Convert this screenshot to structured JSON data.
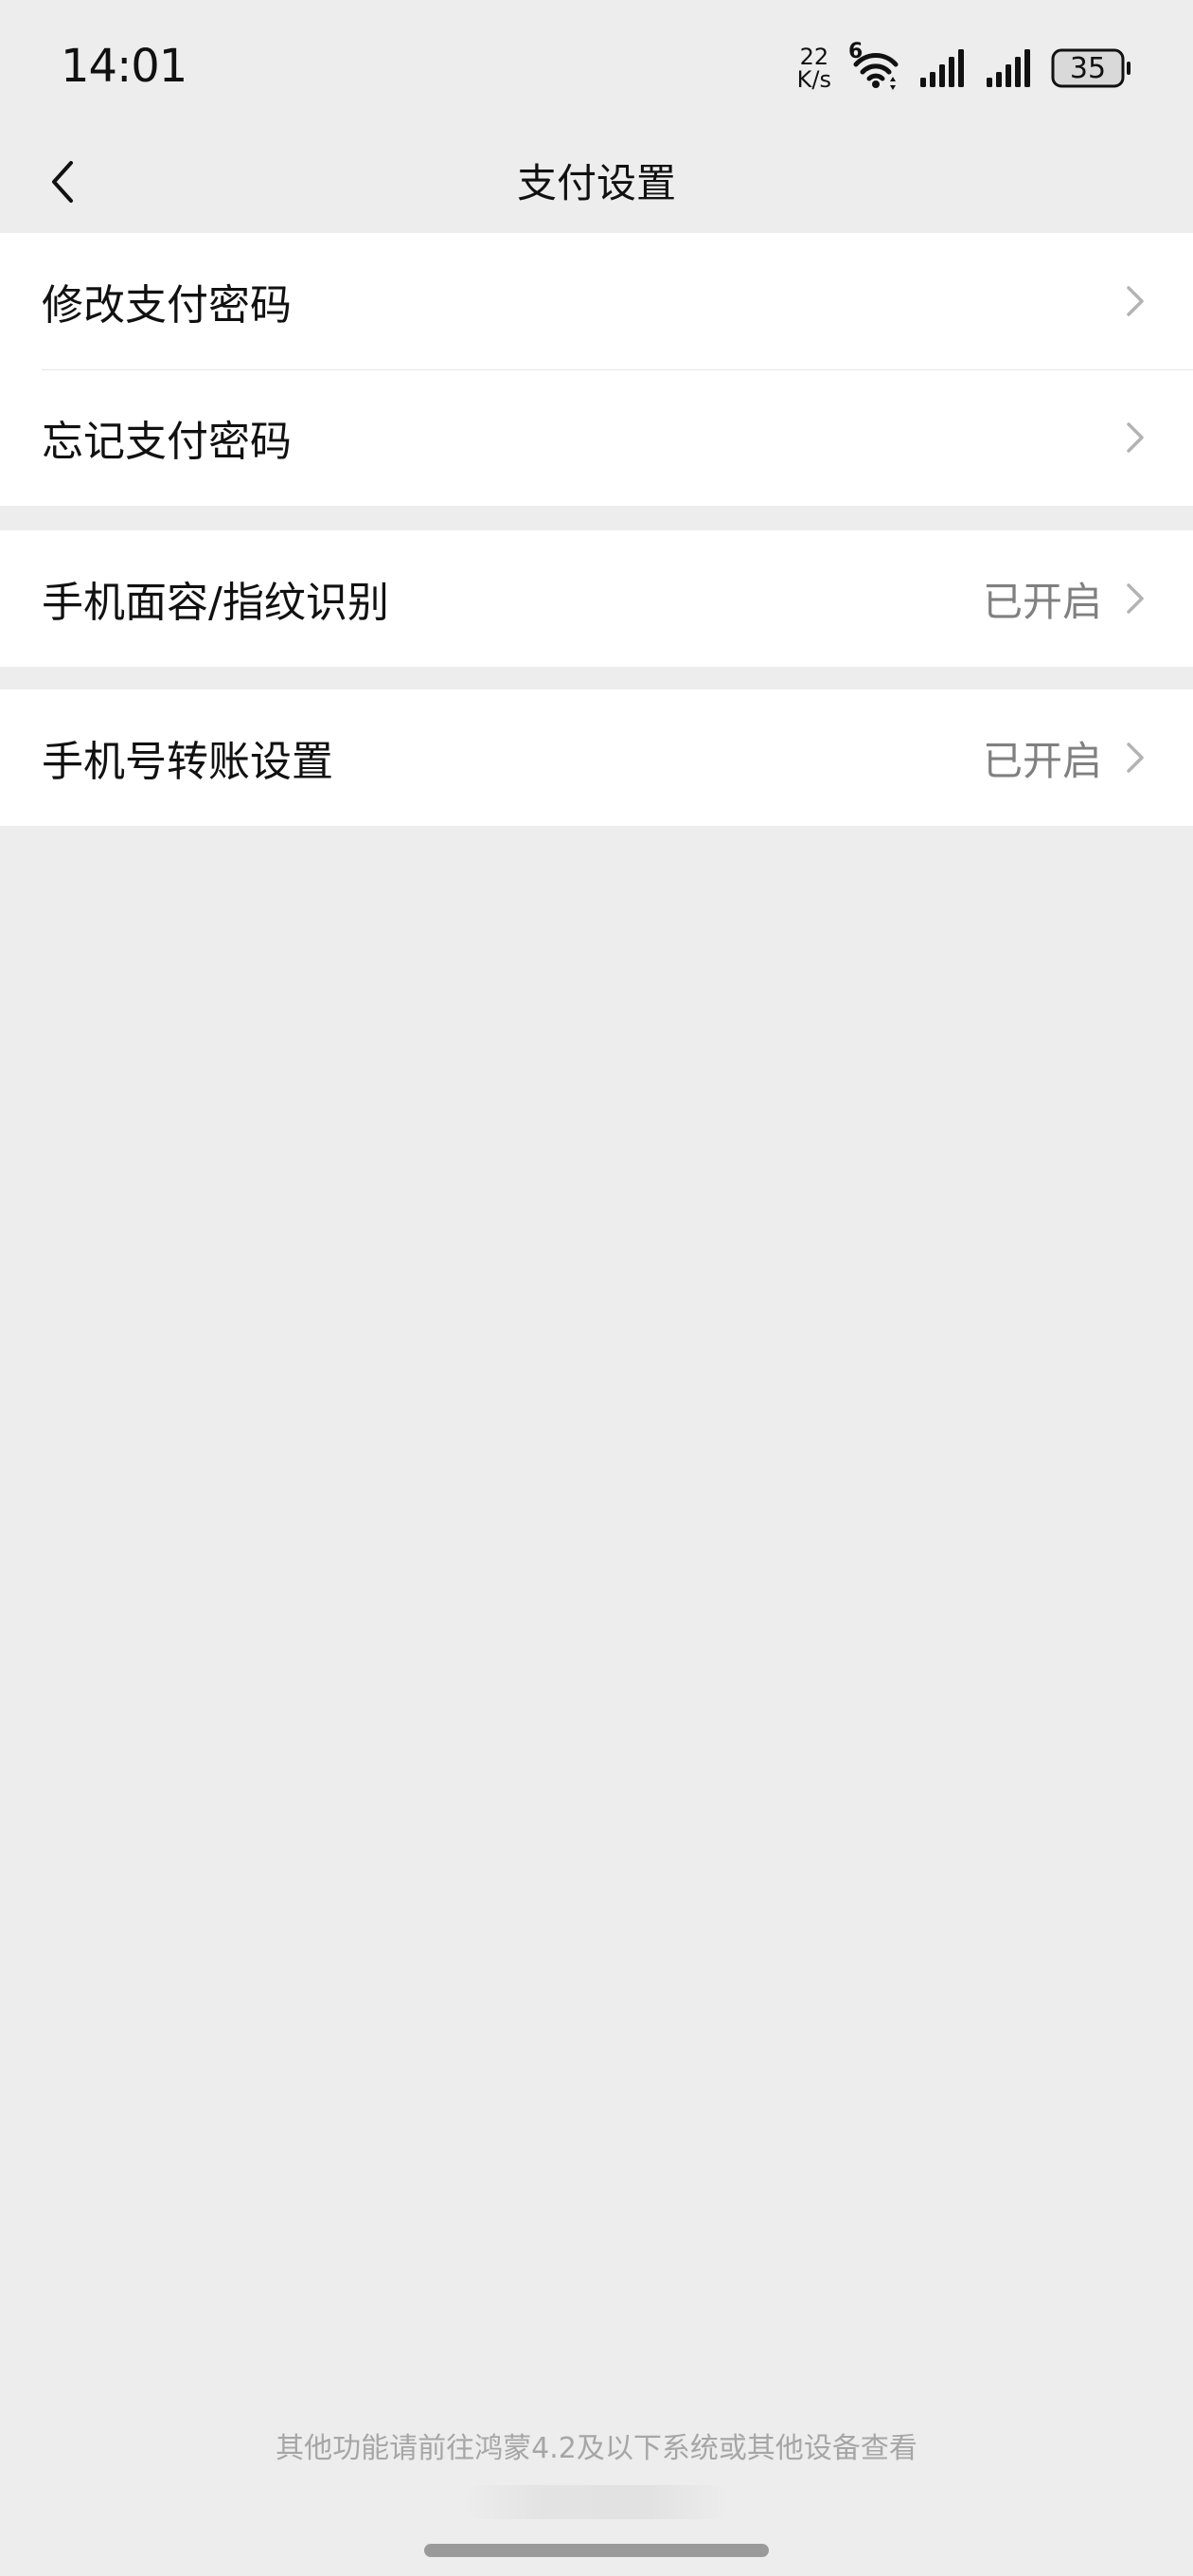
{
  "status_bar": {
    "time": "14:01",
    "net_speed_value": "22",
    "net_speed_unit": "K/s",
    "wifi_badge": "6",
    "battery": "35"
  },
  "nav": {
    "title": "支付设置",
    "back_icon": "chevron-left-icon"
  },
  "groups": [
    {
      "items": [
        {
          "label": "修改支付密码",
          "value": ""
        },
        {
          "label": "忘记支付密码",
          "value": ""
        }
      ]
    },
    {
      "items": [
        {
          "label": "手机面容/指纹识别",
          "value": "已开启"
        }
      ]
    },
    {
      "items": [
        {
          "label": "手机号转账设置",
          "value": "已开启"
        }
      ]
    }
  ],
  "footer": {
    "note": "其他功能请前往鸿蒙4.2及以下系统或其他设备查看"
  },
  "colors": {
    "background": "#ededed",
    "card": "#ffffff",
    "value_text": "#808080",
    "chevron": "#b3b3b3"
  }
}
